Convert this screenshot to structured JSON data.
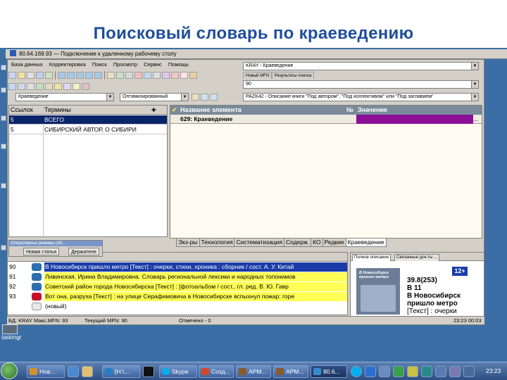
{
  "slide": {
    "title": "Поисковый словарь по краеведению"
  },
  "rdp": {
    "title": "80.64.169.93 — Подключение к удаленному рабочему столу"
  },
  "menu": [
    "База данных",
    "Корректировка",
    "Поиск",
    "Просмотр",
    "Сервис",
    "Помощь"
  ],
  "database_combo": "KRAY - Краеведение",
  "small_tabs": [
    "Новый MFN",
    "Результаты поиска"
  ],
  "mfn_combo": "90",
  "prefix_combo": "Краеведение",
  "mode_combo": "Оптимизированный",
  "worksheet_combo": "PAZK42 - Описание книги \"Под автором\", \"Под коллективом\" или \"Под заглавием\"",
  "dictionary": {
    "columns": [
      "Ссылок",
      "Термины"
    ],
    "rows": [
      {
        "links": "5",
        "term": "ВСЕГО"
      },
      {
        "links": "5",
        "term": "СИБИРСКИЙ АВТОР, О СИБИРИ"
      }
    ]
  },
  "element_grid": {
    "columns": [
      "Название элемента",
      "№",
      "Значение"
    ],
    "row": "629: Краеведение",
    "purple_color": "#8c0f96"
  },
  "bottom_tabs": [
    "Экз-ры",
    "Технология",
    "Систематизация",
    "Содерж.",
    "КО",
    "Редкие",
    "Краеведение"
  ],
  "floating_panel": {
    "caption": "Оперативные режимы (АР...",
    "buttons": [
      "Новая статья",
      "Держатели"
    ]
  },
  "doc_list": {
    "rows": [
      {
        "num": "90",
        "style": "b",
        "icon_color": "#2b6fb0",
        "text": "В Новосибирск пришло метро [Текст] : очерки, стихи, хроника : сборник / сост. А. У. Китай"
      },
      {
        "num": "91",
        "style": "y",
        "icon_color": "#2b6fb0",
        "text": "Ливинская, Ирина Владимировна. Словарь региональной лексики и народных топонимов"
      },
      {
        "num": "92",
        "style": "y",
        "icon_color": "#2b6fb0",
        "text": "Советский район города Новосибирска [Текст] : [фотоальбом / сост., гл. ред. В. Ю. Гавр"
      },
      {
        "num": "93",
        "style": "y",
        "icon_color": "#c8102e",
        "text": "Вот она, разруха [Текст] : на улице Серафимовича в Новосибирске вспыхнул пожар: горе"
      },
      {
        "num": "",
        "style": "",
        "icon_color": "#e8e8e8",
        "text": "(новый)"
      }
    ]
  },
  "description": {
    "tabs": [
      "Полное описание",
      "Связанные док-ты ..."
    ],
    "book_title": "В Новосибирск пришло метро",
    "age_label": "12+",
    "lines": [
      "39.8(253)",
      "В 11",
      "В Новосибирск",
      "пришло метро",
      "[Текст] : очерки"
    ]
  },
  "status": {
    "db": "БД: KRAY Макс.MFN: 93",
    "current": "Текущий MFN: 90",
    "marked": "Отмечено - 0",
    "time": "23:23 00:03"
  },
  "desktop_icon_label": "taskmgr",
  "taskbar": {
    "items": [
      {
        "label": "Нов...",
        "icon_color": "#d4922a",
        "active": false
      },
      {
        "label": "[H:\\...",
        "icon_color": "#2a7ec8",
        "active": false
      },
      {
        "label": "Skype",
        "icon_color": "#00aff0",
        "active": false
      },
      {
        "label": "Созд...",
        "icon_color": "#d04a2a",
        "active": false
      },
      {
        "label": "АРМ...",
        "icon_color": "#8a5a2a",
        "active": false
      },
      {
        "label": "АРМ...",
        "icon_color": "#8a5a2a",
        "active": false
      },
      {
        "label": "80.6...",
        "icon_color": "#3a8ad0",
        "active": true
      }
    ],
    "clock": "23:23"
  }
}
